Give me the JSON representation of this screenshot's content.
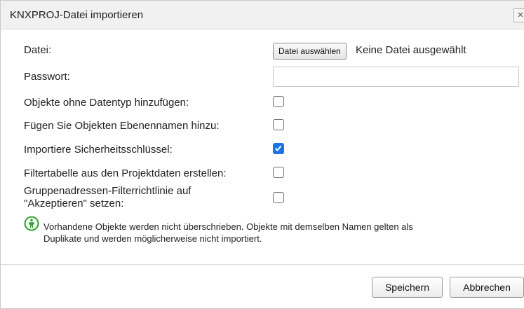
{
  "dialog": {
    "title": "KNXPROJ-Datei importieren",
    "close_glyph": "×"
  },
  "form": {
    "file_label": "Datei:",
    "file_button": "Datei auswählen",
    "file_status": "Keine Datei ausgewählt",
    "password_label": "Passwort:",
    "password_value": "",
    "options": [
      {
        "label": "Objekte ohne Datentyp hinzufügen:",
        "checked": false
      },
      {
        "label": "Fügen Sie Objekten Ebenennamen hinzu:",
        "checked": false
      },
      {
        "label": "Importiere Sicherheitsschlüssel:",
        "checked": true
      },
      {
        "label": "Filtertabelle aus den Projektdaten erstellen:",
        "checked": false
      },
      {
        "label_line1": "Gruppenadressen-Filterrichtlinie auf",
        "label_line2": "\"Akzeptieren\" setzen:",
        "checked": false
      }
    ]
  },
  "info": {
    "icon": "info-person-icon",
    "text_line1": "Vorhandene Objekte werden nicht überschrieben. Objekte mit demselben Namen gelten als",
    "text_line2": "Duplikate und werden möglicherweise nicht importiert."
  },
  "buttons": {
    "save": "Speichern",
    "cancel": "Abbrechen"
  },
  "colors": {
    "accent": "#1a73e8",
    "info_icon": "#2e9e2e"
  }
}
